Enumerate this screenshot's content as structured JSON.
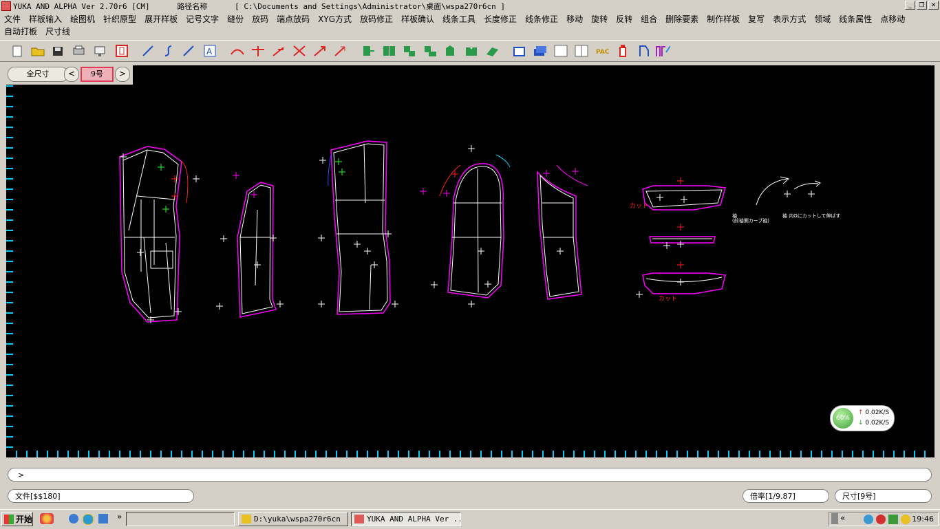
{
  "window": {
    "title": "YUKA AND ALPHA Ver 2.70r6 [CM]      路径名称      [ C:\\Documents and Settings\\Administrator\\桌面\\wspa270r6cn ]",
    "buttons": [
      "_",
      "❐",
      "✕"
    ]
  },
  "menu": {
    "row1": [
      "文件",
      "样板输入",
      "绘图机",
      "针织原型",
      "展开样板",
      "记号文字",
      "缝份",
      "放码",
      "端点放码",
      "XYG方式",
      "放码修正",
      "样板确认",
      "线条工具",
      "长度修正",
      "线条修正",
      "移动",
      "旋转",
      "反转",
      "组合",
      "删除要素",
      "制作样板",
      "复写",
      "表示方式",
      "领域",
      "线条属性",
      "点移动"
    ],
    "row2": [
      "自动打板",
      "尺寸线"
    ]
  },
  "size_panel": {
    "all_size": "全尺寸",
    "prev": "<",
    "current": "9号",
    "next": ">"
  },
  "canvas_labels": {
    "cut1": "カット",
    "cut2": "カット",
    "note1a": "袖",
    "note1b": "(前袖側カーブ袖)",
    "note2": "袖 内Oにカットして伸ばす"
  },
  "net_monitor": {
    "percent": "60%",
    "up": "0.02K/S",
    "down": "0.02K/S"
  },
  "command_line": {
    "prompt": ">"
  },
  "status": {
    "file": "文件[$$180]",
    "zoom": "倍率[1/9.87]",
    "size": "尺寸[9号]"
  },
  "taskbar": {
    "start": "开始",
    "quicklaunch_more": "»",
    "tasks": [
      "D:\\yuka\\wspa270r6cn",
      "YUKA AND ALPHA Ver ..."
    ],
    "tray_more": "«",
    "clock": "19:46"
  },
  "colors": {
    "canvas_bg": "#000000",
    "pattern_outline": "#ff00ff",
    "pattern_inner": "#ffffff",
    "ruler": "#00d0ff",
    "grading_red": "#ff2020",
    "grading_green": "#20ff20"
  }
}
